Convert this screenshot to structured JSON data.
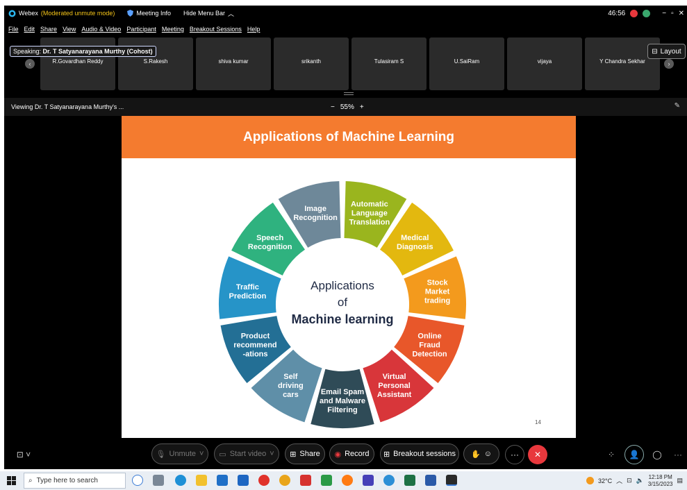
{
  "window": {
    "app_name": "Webex",
    "mode": "(Moderated unmute mode)",
    "meeting_info": "Meeting Info",
    "hide_menu": "Hide Menu Bar",
    "timer": "46:56"
  },
  "menu": [
    "File",
    "Edit",
    "Share",
    "View",
    "Audio & Video",
    "Participant",
    "Meeting",
    "Breakout Sessions",
    "Help"
  ],
  "speaking": {
    "label": "Speaking:",
    "name": "Dr. T Satyanarayana Murthy (Cohost)"
  },
  "participants": [
    "R.Govardhan Reddy",
    "S.Rakesh",
    "shiva kumar",
    "srikanth",
    "Tulasiram S",
    "U.SaiRam",
    "vijaya",
    "Y Chandra Sekhar"
  ],
  "layout_label": "Layout",
  "viewing": "Viewing Dr. T Satyanarayana Murthy's ...",
  "zoom": {
    "minus": "−",
    "level": "55%",
    "plus": "+"
  },
  "slide": {
    "title": "Applications of Machine Learning",
    "center": [
      "Applications",
      "of",
      "Machine learning"
    ],
    "page": "14",
    "segments": [
      {
        "lines": [
          "Automatic",
          "Language",
          "Translation"
        ],
        "color": "#9ab51e"
      },
      {
        "lines": [
          "Medical",
          "Diagnosis"
        ],
        "color": "#e3b80f"
      },
      {
        "lines": [
          "Stock",
          "Market",
          "trading"
        ],
        "color": "#f39a1d"
      },
      {
        "lines": [
          "Online",
          "Fraud",
          "Detection"
        ],
        "color": "#e8572a"
      },
      {
        "lines": [
          "Virtual",
          "Personal",
          "Assistant"
        ],
        "color": "#d8363a"
      },
      {
        "lines": [
          "Email Spam",
          "and Malware",
          "Filtering"
        ],
        "color": "#2f4b57"
      },
      {
        "lines": [
          "Self",
          "driving",
          "cars"
        ],
        "color": "#5f8fa8"
      },
      {
        "lines": [
          "Product",
          "recommend",
          "-ations"
        ],
        "color": "#236f95"
      },
      {
        "lines": [
          "Traffic",
          "Prediction"
        ],
        "color": "#2694c8"
      },
      {
        "lines": [
          "Speech",
          "Recognition"
        ],
        "color": "#2fb27f"
      },
      {
        "lines": [
          "Image",
          "Recognition"
        ],
        "color": "#6e8899"
      }
    ]
  },
  "controls": {
    "unmute": "Unmute",
    "start_video": "Start video",
    "share": "Share",
    "record": "Record",
    "breakout": "Breakout sessions"
  },
  "taskbar": {
    "search_placeholder": "Type here to search",
    "temperature": "32°C",
    "time": "12:18 PM",
    "date": "3/15/2023"
  }
}
